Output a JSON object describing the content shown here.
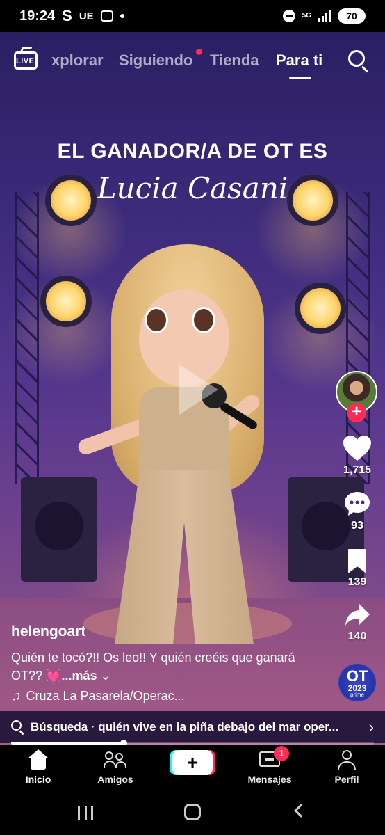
{
  "status_bar": {
    "time": "19:24",
    "carrier_glyph": "S",
    "region": "UE",
    "network": "5G",
    "battery": "70"
  },
  "top_nav": {
    "live_label": "LIVE",
    "tabs": [
      {
        "label": "xplorar",
        "active": false
      },
      {
        "label": "Siguiendo",
        "active": false
      },
      {
        "label": "Tienda",
        "active": false
      },
      {
        "label": "Para ti",
        "active": true
      }
    ]
  },
  "video": {
    "headline": "EL GANADOR/A DE OT ES",
    "name": "Lucia Casani"
  },
  "actions": {
    "likes": "1,715",
    "comments": "93",
    "saves": "139",
    "shares": "140"
  },
  "ot_badge": {
    "logo": "OT",
    "year": "2023",
    "sub": "prime"
  },
  "post": {
    "username": "helengoart",
    "caption": "Quién te tocó?!! Os leo!! Y quién creéis que ganará OT?? 💓",
    "more_label": "...más",
    "music": "Cruza La Pasarela/Operac..."
  },
  "search_suggestion": {
    "prefix": "Búsqueda",
    "query": "quién vive en la piña debajo del mar oper..."
  },
  "progress": 0.31,
  "bottom_nav": {
    "home": "Inicio",
    "friends": "Amigos",
    "inbox": "Mensajes",
    "inbox_badge": "1",
    "profile": "Perfil",
    "create": "+"
  },
  "colors": {
    "accent_red": "#fe2c55",
    "accent_cyan": "#25f4ee"
  }
}
